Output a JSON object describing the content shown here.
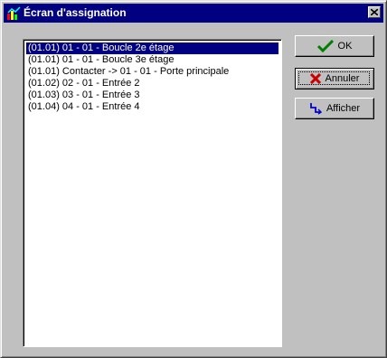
{
  "window": {
    "title": "Écran d'assignation",
    "colors": {
      "titlebar": "#000080",
      "face": "#c0c0c0",
      "selection": "#000080"
    }
  },
  "list": {
    "items": [
      {
        "label": "(01.01) 01 - 01 - Boucle 2e étage",
        "selected": true
      },
      {
        "label": "(01.01) 01 - 01 - Boucle 3e étage",
        "selected": false
      },
      {
        "label": "(01.01) Contacter -> 01 - 01 - Porte principale",
        "selected": false
      },
      {
        "label": "(01.02) 02 - 01 - Entrée 2",
        "selected": false
      },
      {
        "label": "(01.03) 03 - 01 - Entrée 3",
        "selected": false
      },
      {
        "label": "(01.04) 04 - 01 - Entrée 4",
        "selected": false
      }
    ]
  },
  "buttons": {
    "ok": {
      "label": "OK",
      "icon": "checkmark-icon"
    },
    "cancel": {
      "label": "Annuler",
      "icon": "x-icon"
    },
    "show": {
      "label": "Afficher",
      "icon": "arrow-icon"
    }
  }
}
